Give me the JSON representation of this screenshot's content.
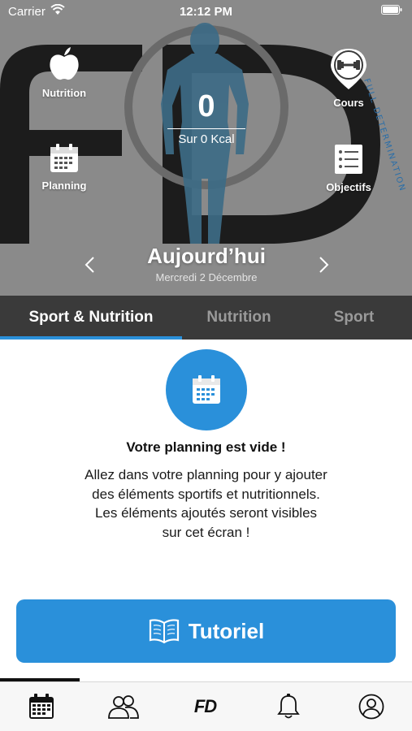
{
  "status_bar": {
    "carrier": "Carrier",
    "time": "12:12 PM"
  },
  "hero": {
    "logo_letters": "FD",
    "brand_arc_text": "FULL DETERMINATION",
    "kcal": {
      "value": "0",
      "label": "Sur 0 Kcal",
      "progress": 0
    },
    "items": {
      "nutrition": {
        "label": "Nutrition",
        "icon": "apple-icon"
      },
      "planning": {
        "label": "Planning",
        "icon": "calendar-icon"
      },
      "cours": {
        "label": "Cours",
        "icon": "dumbbell-icon"
      },
      "objectifs": {
        "label": "Objectifs",
        "icon": "checklist-icon"
      }
    },
    "day_title": "Aujourd’hui",
    "day_date": "Mercredi 2 Décembre"
  },
  "tabs": [
    {
      "label": "Sport & Nutrition",
      "active": true
    },
    {
      "label": "Nutrition",
      "active": false
    },
    {
      "label": "Sport",
      "active": false
    }
  ],
  "empty_state": {
    "title": "Votre planning est vide !",
    "line1": "Allez dans votre planning pour y ajouter",
    "line2": "des éléments sportifs et nutritionnels.",
    "line3": "Les éléments ajoutés seront visibles",
    "line4": "sur cet écran !"
  },
  "tutorial_button": {
    "label": "Tutoriel",
    "icon": "book-icon"
  },
  "bottom_nav": {
    "items": [
      {
        "icon": "calendar-icon",
        "active": true
      },
      {
        "icon": "users-icon",
        "active": false
      },
      {
        "label": "FD",
        "icon": "fd-logo",
        "active": false
      },
      {
        "icon": "bell-icon",
        "active": false
      },
      {
        "icon": "profile-icon",
        "active": false
      }
    ]
  },
  "colors": {
    "accent": "#2a90da",
    "hero_bg": "#8a8a8a",
    "tabs_bg": "#3a3a3a",
    "tab_inactive": "#9a9a9a",
    "figure": "#3d6b86"
  }
}
